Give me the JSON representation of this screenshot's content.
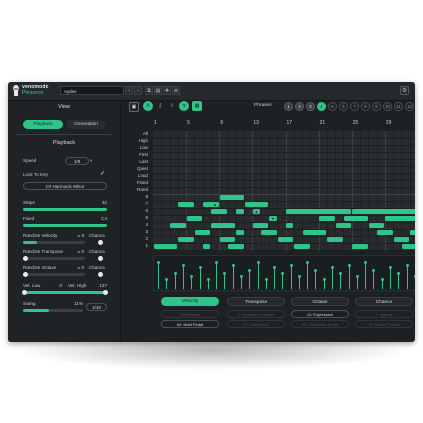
{
  "colors": {
    "accent": "#2fc48a",
    "panel": "#1e2124",
    "grid": "#272b2e"
  },
  "brand": {
    "name": "venomode",
    "product": "Phraseon"
  },
  "toolbar": {
    "preset_value": "Aydee",
    "prev": "‹",
    "next": "›",
    "copy": "⧉",
    "paste": "▤",
    "random": "✚",
    "save": "⊕",
    "settings_icon": "gear-icon",
    "settings_glyph": "⚙"
  },
  "view": {
    "title": "View",
    "tabs": [
      "Playback",
      "Generation"
    ]
  },
  "playback": {
    "title": "Playback",
    "speed": {
      "label": "Speed",
      "value": "1/8"
    },
    "lock_to_key": {
      "label": "Lock To Key",
      "checked": true,
      "check": "✓"
    },
    "scale": "C# Harmonic Minor",
    "steps": {
      "label": "Steps",
      "value": "32",
      "level": 1.0
    },
    "fixed": {
      "label": "Fixed",
      "value": "C4",
      "level": 1.0
    },
    "random_velocity": {
      "label": "Random Velocity",
      "value": "± 6",
      "level": 0.22
    },
    "random_transpose": {
      "label": "Random Transpose",
      "value": "± 0",
      "level": 0.0
    },
    "random_octave": {
      "label": "Random Octave",
      "value": "± 0",
      "level": 0.0
    },
    "chance_label": "Chance",
    "vel_low": {
      "label": "Vel. Low",
      "value": "0"
    },
    "vel_high": {
      "label": "Vel. High",
      "value": "127"
    },
    "swing": {
      "label": "Swing",
      "value": "11%",
      "level": 0.11,
      "division": "1/16"
    }
  },
  "editor": {
    "phrases_label": "Phrases",
    "phrases": [
      "1",
      "2",
      "3",
      "4",
      "5",
      "6",
      "7",
      "8",
      "9",
      "10",
      "11",
      "12"
    ],
    "active_phrase": "4",
    "bar_numbers": [
      "1",
      "5",
      "9",
      "13",
      "17",
      "21",
      "25",
      "29"
    ],
    "row_labels": [
      "All",
      "High",
      "Low",
      "First",
      "Last",
      "Quiet",
      "Loud",
      "Fixed",
      "Rand",
      "8",
      "7",
      "6",
      "5",
      "4",
      "3",
      "2",
      "1"
    ],
    "tool_icons": [
      "grid-icon",
      "pencil-icon",
      "line-icon",
      "curve-icon",
      "shuffle-icon",
      "dice-icon"
    ],
    "tool_glyphs": [
      "▣",
      "ᐱ",
      "∫",
      "⌇",
      "↯",
      "▦"
    ]
  },
  "param_tabs": [
    "Velocity",
    "Transpose",
    "Octave",
    "Chance"
  ],
  "cc_buttons": [
    "Pitch Bend",
    "1: Modulation Wheel",
    "11: Expression",
    "7: Volume",
    "64: Hold Pedal",
    "67: Soft Pedal",
    "66: Sostenuto Pedal",
    "74: Sound Timbre"
  ]
}
